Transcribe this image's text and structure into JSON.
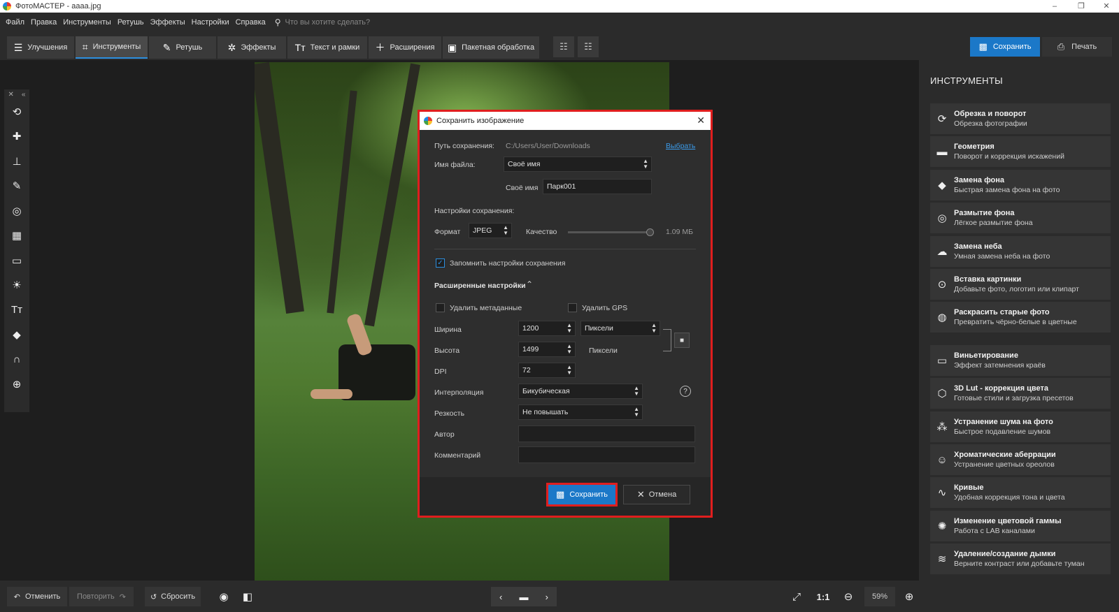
{
  "window": {
    "title": "ФотоМАСТЕР - аааа.jpg",
    "minimize": "–",
    "restore": "❐",
    "close": "✕"
  },
  "menu": {
    "items": [
      "Файл",
      "Правка",
      "Инструменты",
      "Ретушь",
      "Эффекты",
      "Настройки",
      "Справка"
    ],
    "search_placeholder": "Что вы хотите сделать?"
  },
  "toolbar": {
    "tabs": [
      {
        "label": "Улучшения",
        "icon": "sliders-icon"
      },
      {
        "label": "Инструменты",
        "icon": "crop-icon",
        "active": true
      },
      {
        "label": "Ретушь",
        "icon": "brush-icon"
      },
      {
        "label": "Эффекты",
        "icon": "magic-wand-icon"
      },
      {
        "label": "Текст и рамки",
        "icon": "text-icon"
      },
      {
        "label": "Расширения",
        "icon": "plus-icon"
      },
      {
        "label": "Пакетная обработка",
        "icon": "batch-icon"
      }
    ],
    "save_label": "Сохранить",
    "print_label": "Печать"
  },
  "left_tools": [
    "rotate-icon",
    "healing-icon",
    "stamp-icon",
    "brush-icon",
    "radial-icon",
    "gradient-icon",
    "vignette-icon",
    "light-icon",
    "text-icon",
    "fill-icon",
    "curve-icon",
    "globe-icon"
  ],
  "right_panel": {
    "title": "ИНСТРУМЕНТЫ",
    "items": [
      {
        "title": "Обрезка и поворот",
        "subtitle": "Обрезка фотографии"
      },
      {
        "title": "Геометрия",
        "subtitle": "Поворот и коррекция искажений"
      },
      {
        "title": "Замена фона",
        "subtitle": "Быстрая замена фона на фото"
      },
      {
        "title": "Размытие фона",
        "subtitle": "Лёгкое размытие фона"
      },
      {
        "title": "Замена неба",
        "subtitle": "Умная замена неба на фото"
      },
      {
        "title": "Вставка картинки",
        "subtitle": "Добавьте фото, логотип или клипарт"
      },
      {
        "title": "Раскрасить старые фото",
        "subtitle": "Превратить чёрно-белые в цветные"
      },
      {
        "title": "Виньетирование",
        "subtitle": "Эффект затемнения краёв"
      },
      {
        "title": "3D Lut - коррекция цвета",
        "subtitle": "Готовые стили и загрузка пресетов"
      },
      {
        "title": "Устранение шума на фото",
        "subtitle": "Быстрое подавление шумов"
      },
      {
        "title": "Хроматические аберрации",
        "subtitle": "Устранение цветных ореолов"
      },
      {
        "title": "Кривые",
        "subtitle": "Удобная коррекция тона и цвета"
      },
      {
        "title": "Изменение цветовой гаммы",
        "subtitle": "Работа с LAB каналами"
      },
      {
        "title": "Удаление/создание дымки",
        "subtitle": "Верните контраст или добавьте туман"
      }
    ]
  },
  "bottom": {
    "undo": "Отменить",
    "redo": "Повторить",
    "reset": "Сбросить",
    "ratio": "1:1",
    "zoom": "59%"
  },
  "dialog": {
    "title": "Сохранить изображение",
    "path_label": "Путь сохранения:",
    "path_value": "C:/Users/User/Downloads",
    "choose_link": "Выбрать",
    "filename_label": "Имя файла:",
    "filename_mode": "Своё имя",
    "custom_name_label": "Своё имя",
    "custom_name_value": "Парк001",
    "save_settings_label": "Настройки сохранения:",
    "format_label": "Формат",
    "format_value": "JPEG",
    "quality_label": "Качество",
    "quality_fraction": 1.0,
    "file_size": "1.09 МБ",
    "remember_label": "Запомнить настройки сохранения",
    "remember_checked": true,
    "advanced_label": "Расширенные настройки",
    "remove_metadata_label": "Удалить метаданные",
    "remove_gps_label": "Удалить GPS",
    "width_label": "Ширина",
    "width_value": "1200",
    "width_unit": "Пиксели",
    "height_label": "Высота",
    "height_value": "1499",
    "height_unit": "Пиксели",
    "dpi_label": "DPI",
    "dpi_value": "72",
    "interp_label": "Интерполяция",
    "interp_value": "Бикубическая",
    "sharp_label": "Резкость",
    "sharp_value": "Не повышать",
    "author_label": "Автор",
    "author_value": "",
    "comment_label": "Комментарий",
    "comment_value": "",
    "save_button": "Сохранить",
    "cancel_button": "Отмена"
  },
  "colors": {
    "accent": "#1b78c8",
    "highlight": "#e01e1e",
    "panel": "#2b2b2b"
  }
}
